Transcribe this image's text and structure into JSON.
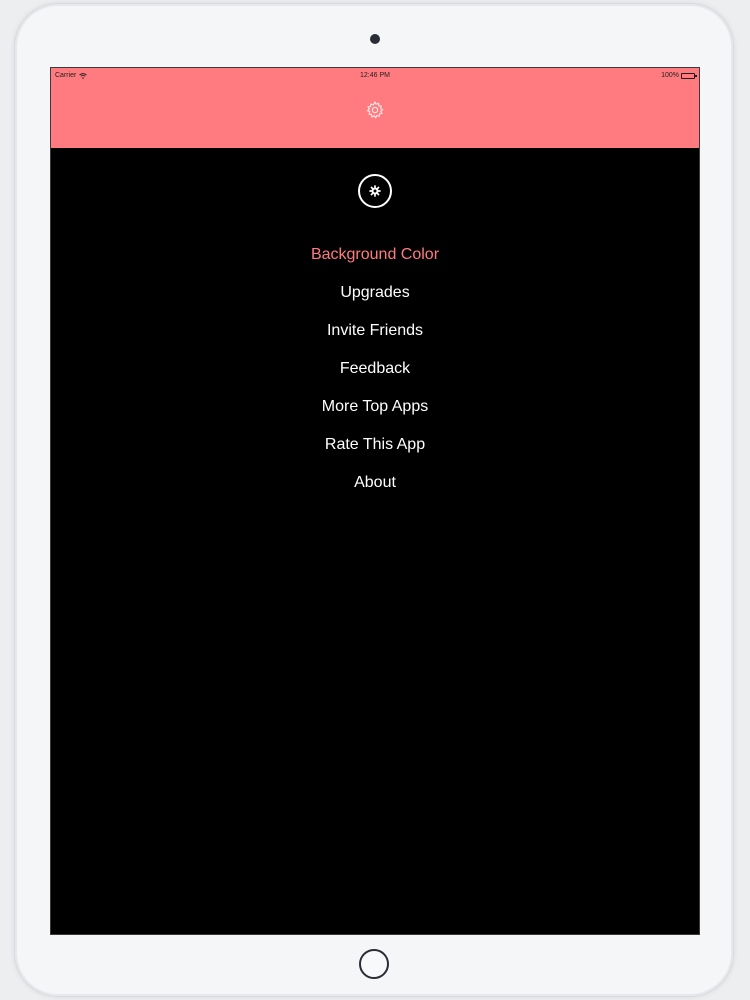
{
  "status_bar": {
    "carrier": "Carrier",
    "time": "12:46 PM",
    "battery": "100%",
    "battery_level": 1.0
  },
  "header": {
    "icon": "gear-icon",
    "color": "#ff7b7f"
  },
  "menu": {
    "icon": "gear-icon",
    "items": [
      {
        "label": "Background Color",
        "active": true
      },
      {
        "label": "Upgrades",
        "active": false
      },
      {
        "label": "Invite Friends",
        "active": false
      },
      {
        "label": "Feedback",
        "active": false
      },
      {
        "label": "More Top Apps",
        "active": false
      },
      {
        "label": "Rate This App",
        "active": false
      },
      {
        "label": "About",
        "active": false
      }
    ]
  },
  "colors": {
    "accent": "#ff7b7f",
    "background": "#000000",
    "text": "#ffffff"
  }
}
